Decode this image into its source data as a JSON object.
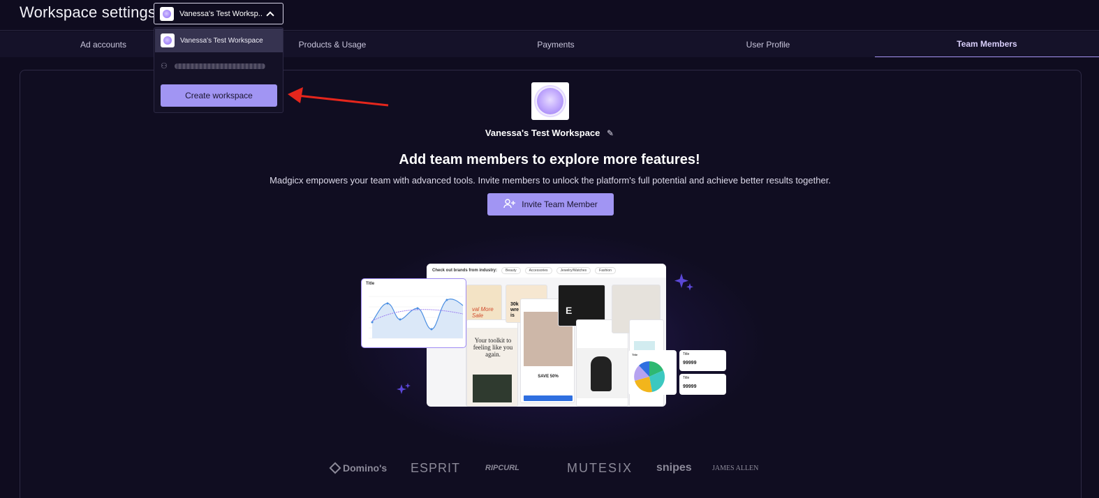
{
  "header": {
    "title": "Workspace settings",
    "workspace_select": {
      "value": "Vanessa's Test Worksp...",
      "icon": "chevron-up-icon"
    }
  },
  "tabs": [
    {
      "label": "Ad accounts",
      "active": false
    },
    {
      "label": "Products & Usage",
      "active": false
    },
    {
      "label": "Payments",
      "active": false
    },
    {
      "label": "User Profile",
      "active": false
    },
    {
      "label": "Team Members",
      "active": true
    }
  ],
  "dropdown": {
    "items": [
      {
        "label": "Vanessa's Test Workspace",
        "selected": true
      },
      {
        "label": "",
        "blurred": true
      }
    ],
    "create_label": "Create workspace"
  },
  "annotation": {
    "color": "#e5261c"
  },
  "main": {
    "workspace_name": "Vanessa's Test Workspace",
    "headline": "Add team members to explore more features!",
    "subline": "Madgicx empowers your team with advanced tools. Invite members to unlock the platform's full potential and achieve better results together.",
    "invite_label": "Invite Team Member"
  },
  "illustration": {
    "panel_title": "Check out brands from industry:",
    "chips": [
      "Beauty",
      "Accessories",
      "Jewelry/Watches",
      "Fashion"
    ],
    "chart_title": "Title",
    "toolkit_text": "Your toolkit to feeling like you again.",
    "sale_text": "SAVE 50%",
    "stat_title": "Title",
    "stat_value": "99999"
  },
  "logos": [
    "Domino's",
    "ESPRIT",
    "RIPCURL",
    "MUTESIX",
    "snipes",
    "JAMES ALLEN"
  ],
  "colors": {
    "background": "#0f0c1f",
    "accent": "#a195f3",
    "active_tab": "#d9cffb"
  }
}
